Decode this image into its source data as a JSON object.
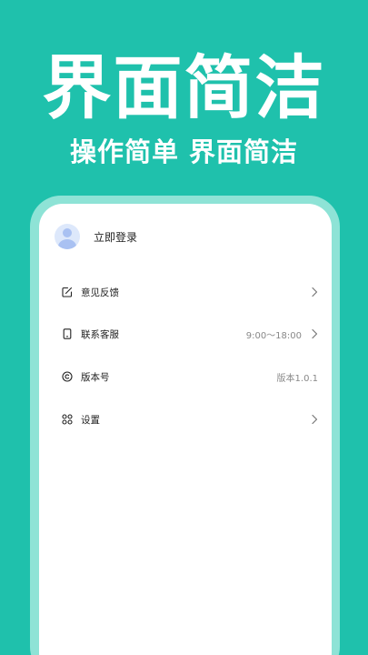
{
  "hero": {
    "title": "界面简洁",
    "subtitle": "操作简单 界面简洁"
  },
  "profile": {
    "login_label": "立即登录",
    "avatar_icon": "user-avatar-icon"
  },
  "menu": {
    "items": [
      {
        "label": "意见反馈",
        "value": "",
        "icon": "edit-icon",
        "has_chevron": true
      },
      {
        "label": "联系客服",
        "value": "9:00～18:00",
        "icon": "phone-icon",
        "has_chevron": true
      },
      {
        "label": "版本号",
        "value": "版本1.0.1",
        "icon": "copyright-icon",
        "has_chevron": false
      },
      {
        "label": "设置",
        "value": "",
        "icon": "grid-icon",
        "has_chevron": true
      }
    ]
  },
  "colors": {
    "background": "#1fc1ac",
    "frame": "#8ee3d6",
    "screen": "#ffffff",
    "text": "#222222",
    "muted": "#888888"
  }
}
